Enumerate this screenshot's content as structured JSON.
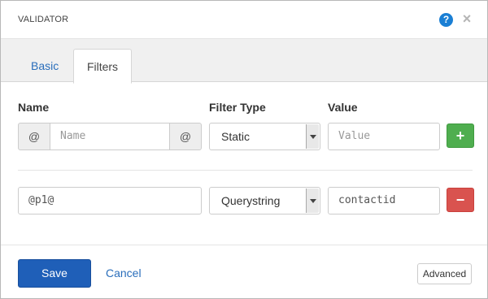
{
  "dialog": {
    "title": "VALIDATOR",
    "help_icon": "?",
    "close_icon": "×"
  },
  "tabs": [
    {
      "label": "Basic",
      "active": false
    },
    {
      "label": "Filters",
      "active": true
    }
  ],
  "columns": {
    "name": "Name",
    "filter_type": "Filter Type",
    "value": "Value"
  },
  "new_filter": {
    "prefix": "@",
    "suffix": "@",
    "name_placeholder": "Name",
    "filter_type": "Static",
    "value_placeholder": "Value",
    "add_label": "+"
  },
  "filters": [
    {
      "name": "@p1@",
      "filter_type": "Querystring",
      "value": "contactid",
      "remove_label": "−"
    }
  ],
  "footer": {
    "save_label": "Save",
    "cancel_label": "Cancel",
    "advanced_label": "Advanced"
  },
  "colors": {
    "primary": "#1f5fb8",
    "link": "#2a6ebb",
    "success": "#4fae4f",
    "danger": "#d9534f",
    "help": "#1a7fd4"
  }
}
